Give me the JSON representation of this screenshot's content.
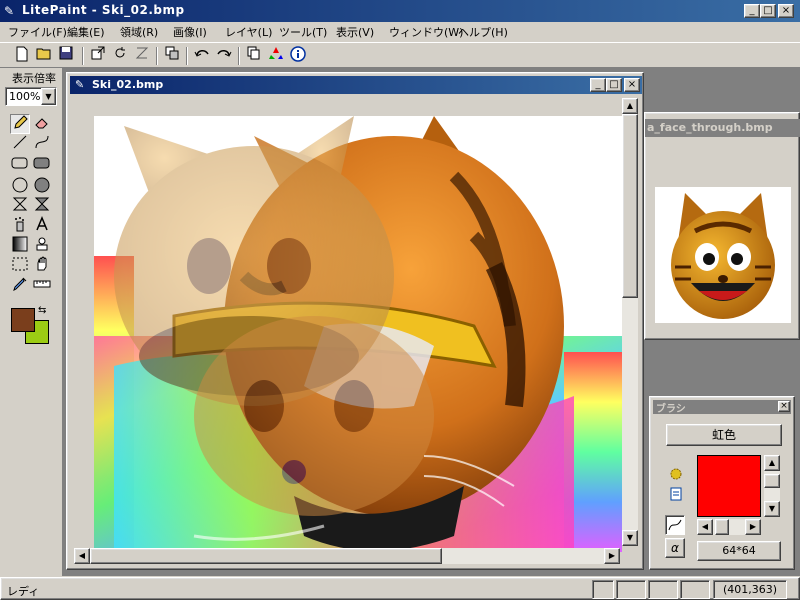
{
  "window": {
    "title": "LitePaint - Ski_02.bmp",
    "minimize": "_",
    "maximize": "□",
    "close": "×"
  },
  "menu": [
    "ファイル(F)",
    "編集(E)",
    "領域(R)",
    "画像(I)",
    "レイヤ(L)",
    "ツール(T)",
    "表示(V)",
    "ウィンドウ(W)",
    "ヘルプ(H)"
  ],
  "toolbar": {
    "icons": [
      "new-icon",
      "open-icon",
      "save-icon",
      "resize-icon",
      "rotate-icon",
      "flip-icon",
      "layers-icon",
      "undo-icon",
      "redo-icon",
      "copy-icon",
      "color-icon",
      "info-icon"
    ]
  },
  "tools": {
    "zoom_label": "表示倍率",
    "zoom_value": "100%",
    "fg_color": "#7a3e1c",
    "bg_color": "#9ccc14"
  },
  "document": {
    "title": "Ski_02.bmp"
  },
  "second_window": {
    "title": "a_face_through.bmp"
  },
  "brush": {
    "panel_title": "ブラシ",
    "preset_label": "虹色",
    "color": "#ff0000",
    "size_label": "64*64",
    "alpha_label": "α"
  },
  "status": {
    "text": "レディ",
    "coords": "(401,363)"
  }
}
